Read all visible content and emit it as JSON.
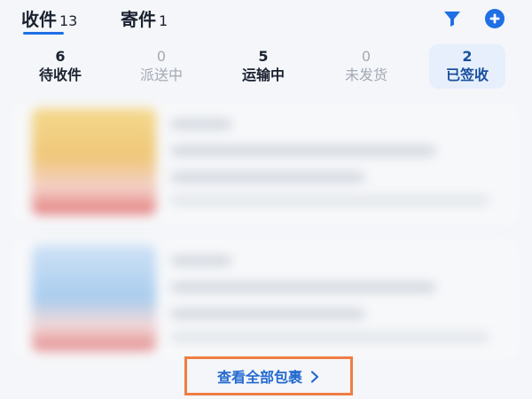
{
  "tabs": [
    {
      "label": "收件",
      "count": "13"
    },
    {
      "label": "寄件",
      "count": "1"
    }
  ],
  "icons": {
    "filter": "filter-icon",
    "add": "add-circle-icon"
  },
  "colors": {
    "accent": "#1f6fe5",
    "highlight_border": "#ef7d43",
    "active_bg": "#e6effb"
  },
  "status": [
    {
      "count": "6",
      "label": "待收件"
    },
    {
      "count": "0",
      "label": "派送中"
    },
    {
      "count": "5",
      "label": "运输中"
    },
    {
      "count": "0",
      "label": "未发货"
    },
    {
      "count": "2",
      "label": "已签收"
    }
  ],
  "view_all": {
    "label": "查看全部包裹"
  }
}
